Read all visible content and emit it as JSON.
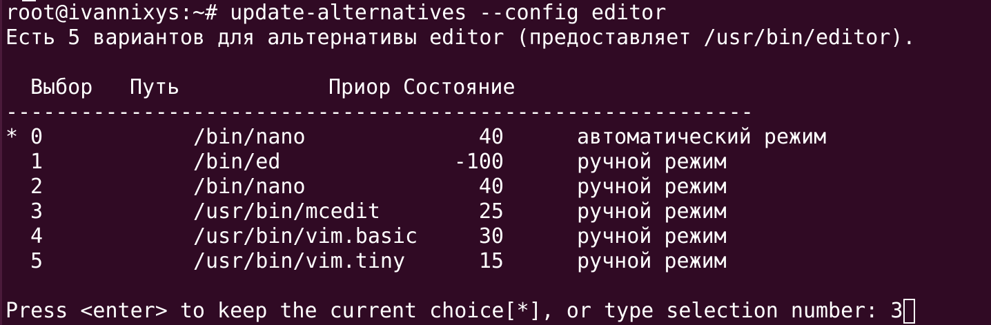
{
  "terminal": {
    "command_line": "root@ivannixys:~# update-alternatives --config editor",
    "info_line": "Есть 5 вариантов для альтернативы editor (предоставляет /usr/bin/editor).",
    "headers": {
      "selection": "Выбор",
      "path": "Путь",
      "priority": "Приор",
      "status": "Состояние"
    },
    "separator": "------------------------------------------------------------",
    "rows": [
      {
        "mark": "*",
        "selection": "0",
        "path": "/bin/nano",
        "priority": "40",
        "status": "автоматический режим"
      },
      {
        "mark": "",
        "selection": "1",
        "path": "/bin/ed",
        "priority": "-100",
        "status": "ручной режим"
      },
      {
        "mark": "",
        "selection": "2",
        "path": "/bin/nano",
        "priority": "40",
        "status": "ручной режим"
      },
      {
        "mark": "",
        "selection": "3",
        "path": "/usr/bin/mcedit",
        "priority": "25",
        "status": "ручной режим"
      },
      {
        "mark": "",
        "selection": "4",
        "path": "/usr/bin/vim.basic",
        "priority": "30",
        "status": "ручной режим"
      },
      {
        "mark": "",
        "selection": "5",
        "path": "/usr/bin/vim.tiny",
        "priority": "15",
        "status": "ручной режим"
      }
    ],
    "prompt": "Press <enter> to keep the current choice[*], or type selection number: ",
    "input_value": "3",
    "colors": {
      "background": "#300a24",
      "foreground": "#ffffff"
    }
  }
}
